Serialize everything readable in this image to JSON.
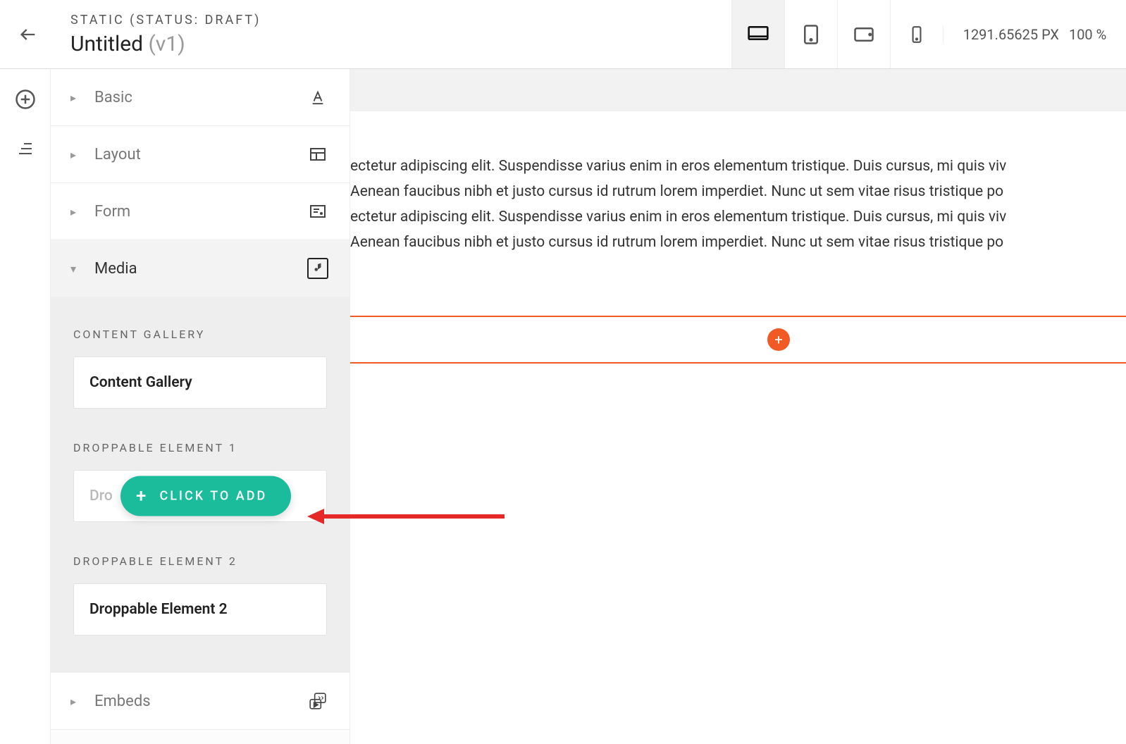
{
  "header": {
    "status_label": "STATIC (STATUS: DRAFT)",
    "page_name": "Untitled",
    "page_version": "(v1)"
  },
  "viewports": [
    {
      "id": "desktop",
      "active": true
    },
    {
      "id": "tablet-portrait",
      "active": false
    },
    {
      "id": "tablet-landscape",
      "active": false
    },
    {
      "id": "mobile",
      "active": false
    }
  ],
  "status_panel": {
    "width_label": "1291.65625 PX",
    "zoom_label": "100 %"
  },
  "sidebar_sections": [
    {
      "id": "basic",
      "label": "Basic",
      "open": false,
      "right_icon": "text-color-icon"
    },
    {
      "id": "layout",
      "label": "Layout",
      "open": false,
      "right_icon": "layout-icon"
    },
    {
      "id": "form",
      "label": "Form",
      "open": false,
      "right_icon": "form-icon"
    },
    {
      "id": "media",
      "label": "Media",
      "open": true,
      "right_icon": "media-icon"
    },
    {
      "id": "embeds",
      "label": "Embeds",
      "open": false,
      "right_icon": "embed-icon"
    }
  ],
  "media_cards": [
    {
      "heading": "CONTENT GALLERY",
      "tile": "Content Gallery",
      "show_click_to_add": false
    },
    {
      "heading": "DROPPABLE ELEMENT 1",
      "tile": "Dro",
      "show_click_to_add": true
    },
    {
      "heading": "DROPPABLE ELEMENT 2",
      "tile": "Droppable Element 2",
      "show_click_to_add": false
    }
  ],
  "click_to_add_label": "CLICK TO ADD",
  "canvas": {
    "text_lines": [
      "ectetur adipiscing elit. Suspendisse varius enim in eros elementum tristique. Duis cursus, mi quis viv",
      "Aenean faucibus nibh et justo cursus id rutrum lorem imperdiet. Nunc ut sem vitae risus tristique po",
      "ectetur adipiscing elit. Suspendisse varius enim in eros elementum tristique. Duis cursus, mi quis viv",
      "Aenean faucibus nibh et justo cursus id rutrum lorem imperdiet. Nunc ut sem vitae risus tristique po"
    ]
  },
  "colors": {
    "accent_teal": "#1abc9c",
    "accent_orange": "#f15a24"
  }
}
